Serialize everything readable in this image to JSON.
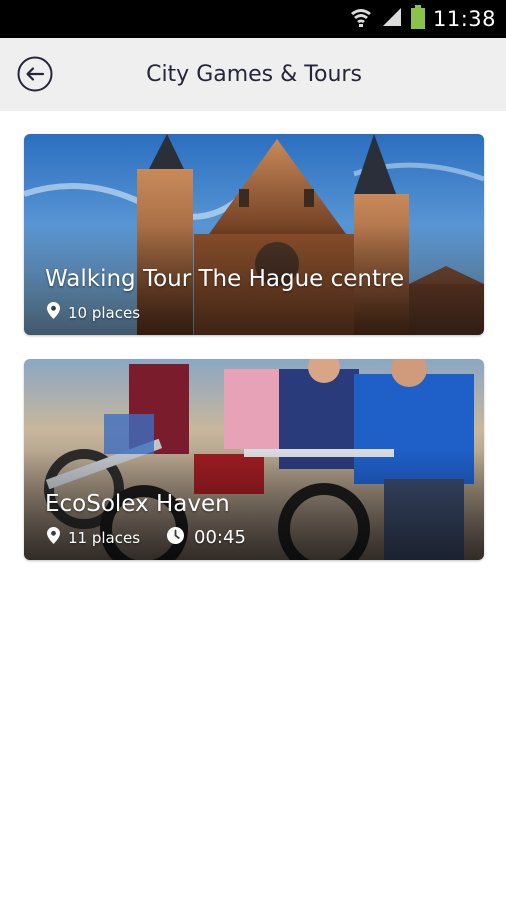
{
  "status_bar": {
    "time": "11:38",
    "icons": [
      "wifi-icon",
      "cell-signal-icon",
      "battery-icon"
    ]
  },
  "header": {
    "title": "City Games & Tours",
    "back_icon": "back-arrow-icon"
  },
  "tours": [
    {
      "title": "Walking Tour The Hague centre",
      "places": "10 places",
      "place_icon": "location-pin-icon"
    },
    {
      "title": "EcoSolex Haven",
      "places": "11 places",
      "duration": "00:45",
      "place_icon": "location-pin-icon",
      "duration_icon": "clock-icon"
    }
  ],
  "colors": {
    "status_bar": "#000000",
    "app_bar": "#efefef",
    "title_text": "#26263a",
    "background": "#ffffff"
  }
}
